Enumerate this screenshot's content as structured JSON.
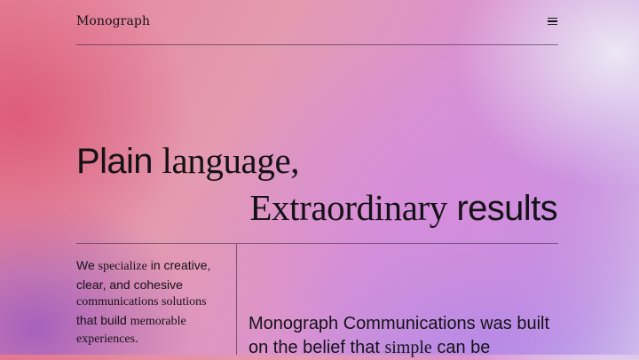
{
  "header": {
    "logo": "Monograph",
    "menu_icon": "hamburger-menu-icon"
  },
  "hero": {
    "line1_a": "Plain",
    "line1_b": "language,",
    "line2_a": "Extraordinary",
    "line2_b": "results"
  },
  "intro": {
    "p1_a": "We",
    "p1_b": "specialize",
    "p1_c": "in creative,",
    "p2": "clear, and cohesive",
    "p3": "communications solutions",
    "p4_a": "that build",
    "p4_b": "memorable",
    "p5": "experiences."
  },
  "statement": {
    "s1": "Monograph Communications was built",
    "s2_a": "on the belief that",
    "s2_b": "simple",
    "s2_c": "can be"
  }
}
